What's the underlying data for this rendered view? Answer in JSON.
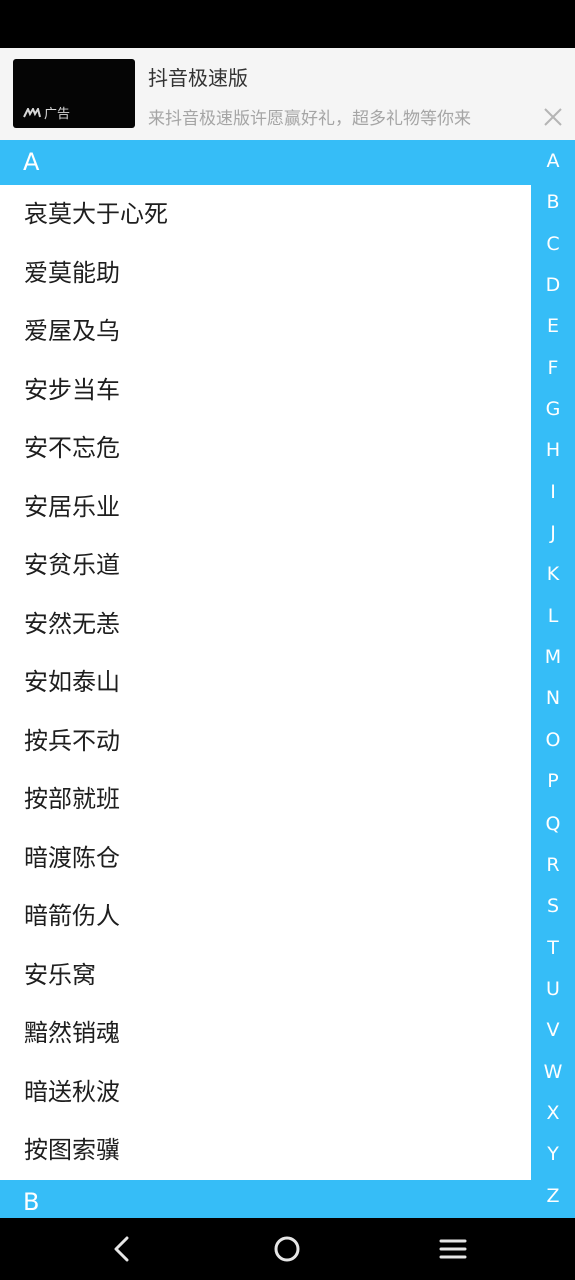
{
  "ad": {
    "badge": "广告",
    "title": "抖音极速版",
    "description": "来抖音极速版许愿赢好礼，超多礼物等你来"
  },
  "sections": [
    {
      "letter": "A",
      "items": [
        "哀莫大于心死",
        "爱莫能助",
        "爱屋及乌",
        "安步当车",
        "安不忘危",
        "安居乐业",
        "安贫乐道",
        "安然无恙",
        "安如泰山",
        "按兵不动",
        "按部就班",
        "暗渡陈仓",
        "暗箭伤人",
        "安乐窝",
        "黯然销魂",
        "暗送秋波",
        "按图索骥"
      ]
    },
    {
      "letter": "B",
      "items": []
    }
  ],
  "index_letters": [
    "A",
    "B",
    "C",
    "D",
    "E",
    "F",
    "G",
    "H",
    "I",
    "J",
    "K",
    "L",
    "M",
    "N",
    "O",
    "P",
    "Q",
    "R",
    "S",
    "T",
    "U",
    "V",
    "W",
    "X",
    "Y",
    "Z"
  ],
  "nav": {
    "back": "back-icon",
    "home": "home-icon",
    "menu": "menu-icon"
  },
  "colors": {
    "accent": "#36bdf7",
    "text": "#1e1e1e"
  }
}
